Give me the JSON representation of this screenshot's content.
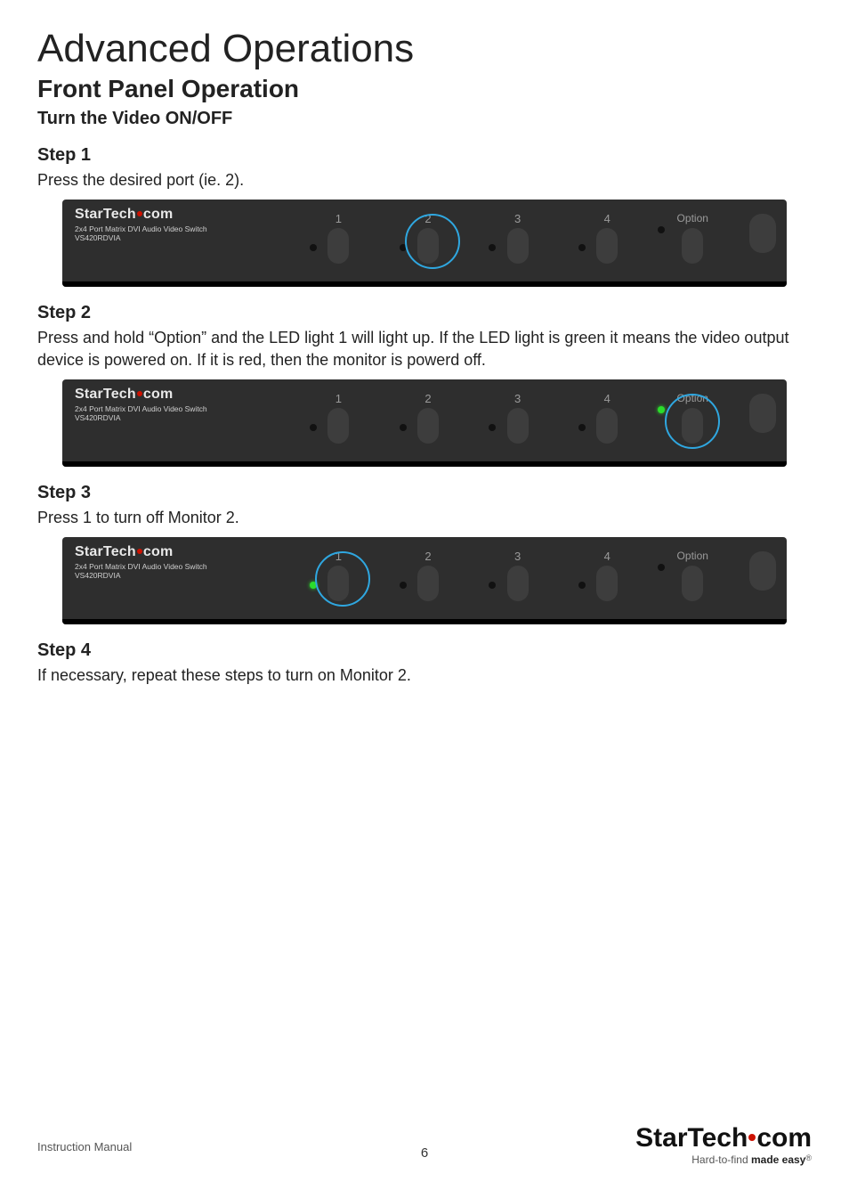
{
  "title": "Advanced Operations",
  "section": "Front Panel Operation",
  "subsection": "Turn the Video ON/OFF",
  "steps": [
    {
      "heading": "Step 1",
      "text": "Press the desired port (ie. 2)."
    },
    {
      "heading": "Step 2",
      "text": "Press and hold “Option” and the LED light 1 will light up. If the LED light is green it means the video output device is powered on. If it is red, then the monitor is powerd off."
    },
    {
      "heading": "Step 3",
      "text": "Press 1 to turn off Monitor 2."
    },
    {
      "heading": "Step 4",
      "text": "If necessary, repeat these steps to turn on Monitor 2."
    }
  ],
  "panel": {
    "brand": "StarTech.com",
    "desc": "2x4 Port Matrix DVI Audio Video Switch",
    "model": "VS420RDVIA",
    "buttons": [
      "1",
      "2",
      "3",
      "4"
    ],
    "option_label": "Option"
  },
  "panels": [
    {
      "highlight": "button2",
      "option_led_green": false
    },
    {
      "highlight": "option",
      "option_led_green": true
    },
    {
      "highlight": "button1",
      "option_led_green": false
    }
  ],
  "footer": {
    "instruction_manual": "Instruction Manual",
    "page_number": "6",
    "logo": "StarTech.com",
    "tagline_plain": "Hard-to-find ",
    "tagline_bold": "made easy",
    "reg": "®"
  }
}
